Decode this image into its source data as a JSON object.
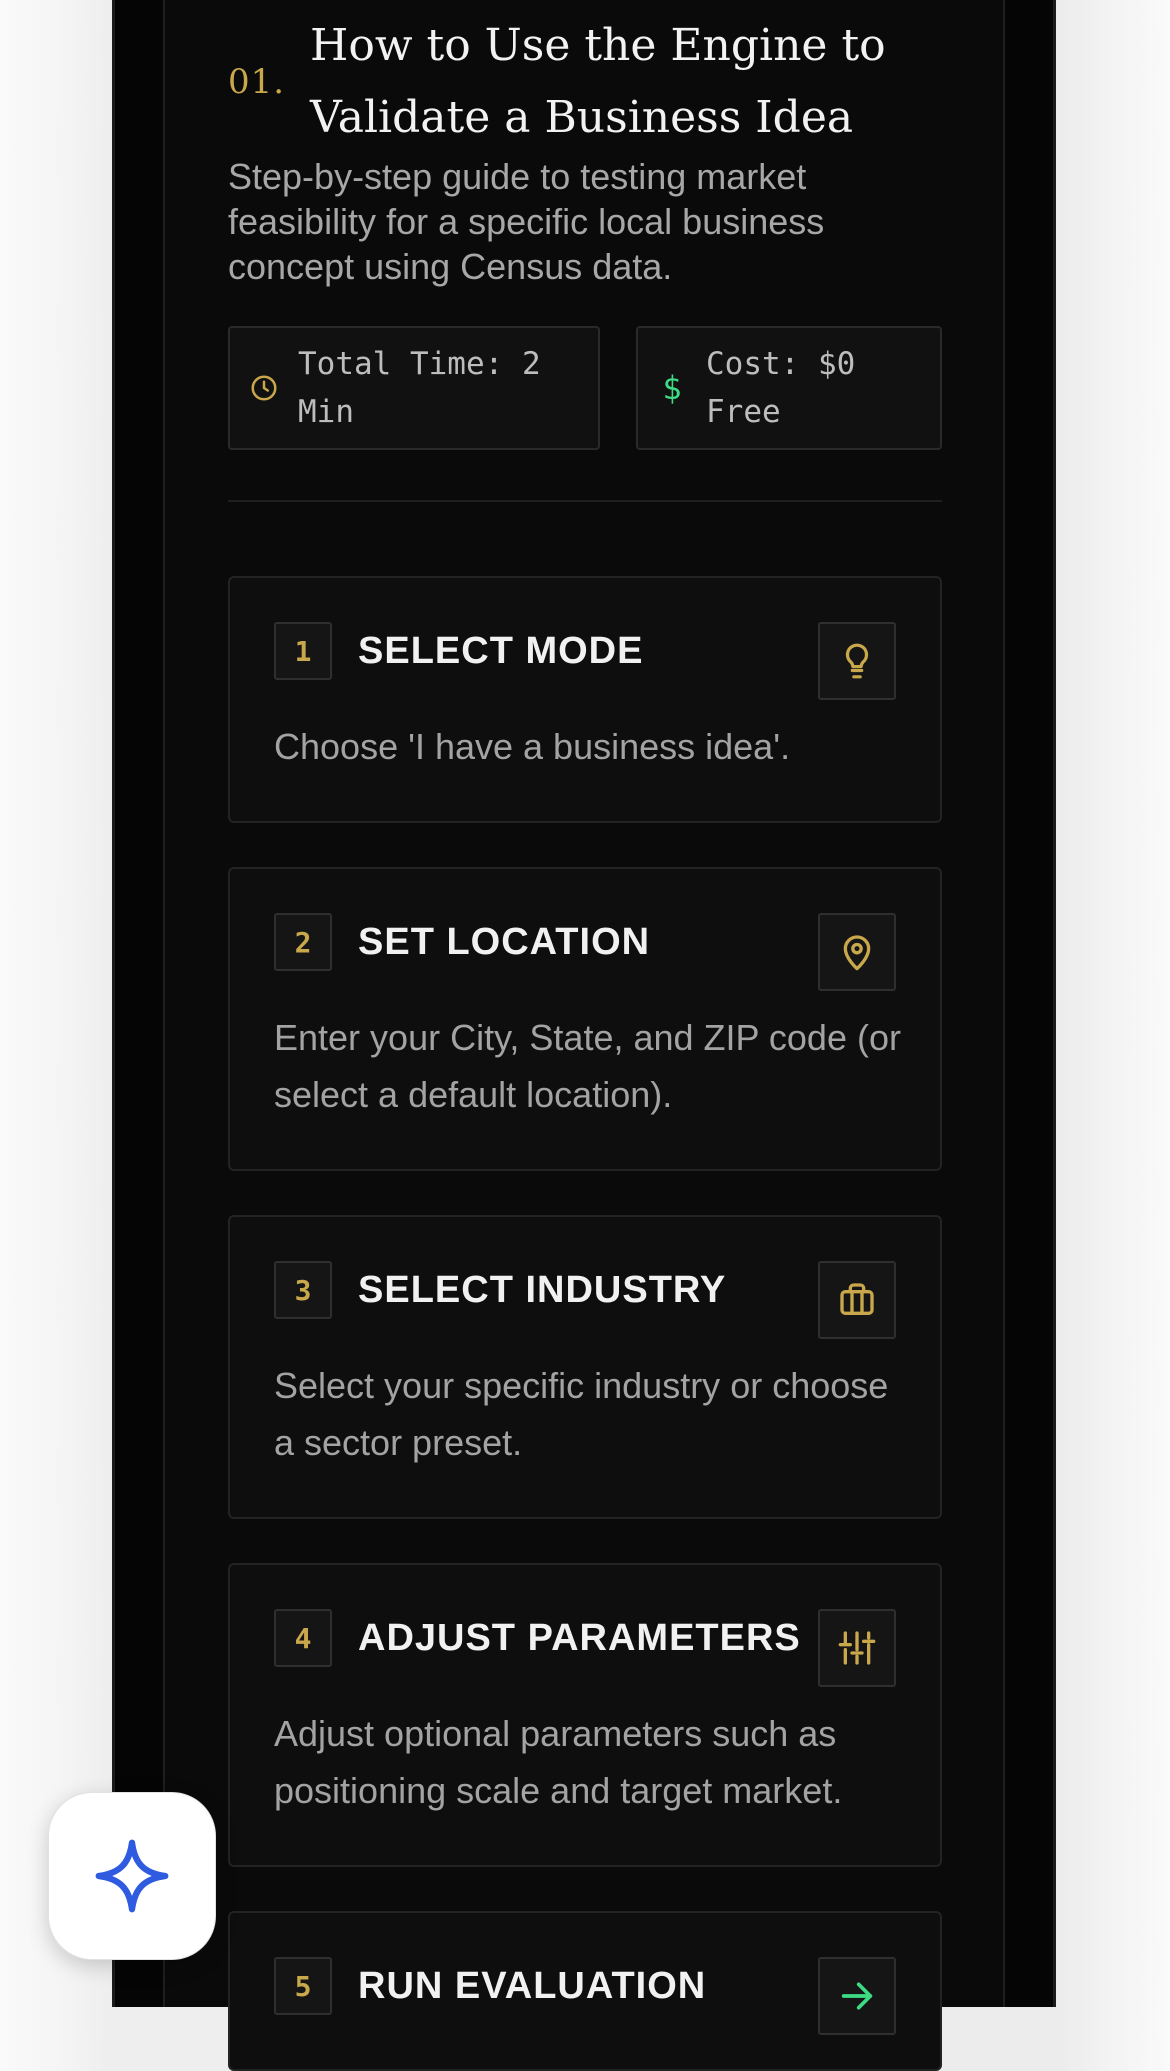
{
  "section": {
    "number": "01.",
    "title": "How to Use the Engine to Validate a Business Idea",
    "description": "Step-by-step guide to testing market feasibility for a specific local business concept using Census data."
  },
  "meta": {
    "time_label": "Total Time: 2 Min",
    "cost_label": "Cost: $0 Free"
  },
  "steps": [
    {
      "number": "1",
      "title": "SELECT MODE",
      "description": "Choose 'I have a business idea'.",
      "icon": "lightbulb-icon"
    },
    {
      "number": "2",
      "title": "SET LOCATION",
      "description": "Enter your City, State, and ZIP code (or select a default location).",
      "icon": "map-pin-icon"
    },
    {
      "number": "3",
      "title": "SELECT INDUSTRY",
      "description": "Select your specific industry or choose a sector preset.",
      "icon": "briefcase-icon"
    },
    {
      "number": "4",
      "title": "ADJUST PARAMETERS",
      "description": "Adjust optional parameters such as positioning scale and target market.",
      "icon": "sliders-icon"
    },
    {
      "number": "5",
      "title": "RUN EVALUATION",
      "description": "",
      "icon": "arrow-right-icon"
    }
  ],
  "colors": {
    "accent_gold": "#c9a84b",
    "accent_green": "#3ddc84",
    "ai_star_blue": "#2f5be0",
    "background": "#0a0a0a"
  }
}
